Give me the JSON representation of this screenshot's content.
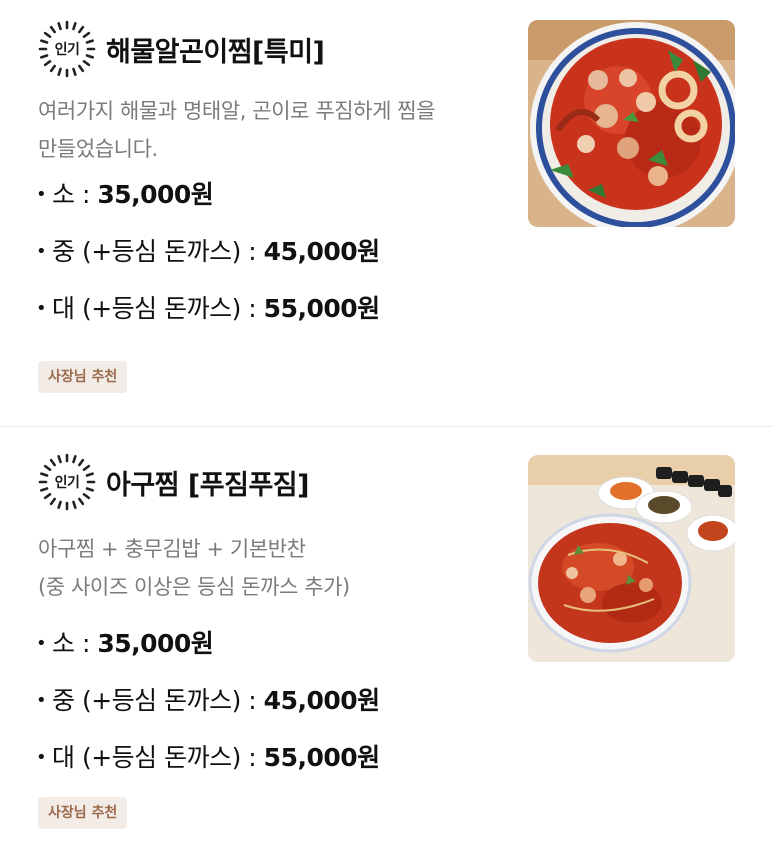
{
  "menu": {
    "items": [
      {
        "badge": "인기",
        "title": "해물알곤이찜[특미]",
        "description_lines": [
          "여러가지 해물과 명태알, 곤이로 푸짐하게 찜을",
          "만들었습니다."
        ],
        "prices": [
          {
            "bullet": "•",
            "size": "소 : ",
            "price": "35,000원"
          },
          {
            "bullet": "•",
            "size": "중 (+등심 돈까스) : ",
            "price": "45,000원"
          },
          {
            "bullet": "•",
            "size": "대 (+등심 돈까스) : ",
            "price": "55,000원"
          }
        ],
        "owner_badge": "사장님 추천",
        "photo": "seafood-steam-photo"
      },
      {
        "badge": "인기",
        "title": "아구찜 [푸짐푸짐]",
        "description_lines": [
          "아구찜 + 충무김밥 + 기본반찬",
          "(중 사이즈 이상은 등심 돈까스 추가)"
        ],
        "prices": [
          {
            "bullet": "•",
            "size": "소 : ",
            "price": "35,000원"
          },
          {
            "bullet": "•",
            "size": "중 (+등심 돈까스) : ",
            "price": "45,000원"
          },
          {
            "bullet": "•",
            "size": "대 (+등심 돈까스) : ",
            "price": "55,000원"
          }
        ],
        "owner_badge": "사장님 추천",
        "photo": "monkfish-steam-photo"
      }
    ]
  },
  "colors": {
    "title": "#111111",
    "description": "#7b7b7b",
    "owner_badge_bg": "#f3ece6",
    "owner_badge_text": "#9a6a4d",
    "divider": "#ececec"
  }
}
